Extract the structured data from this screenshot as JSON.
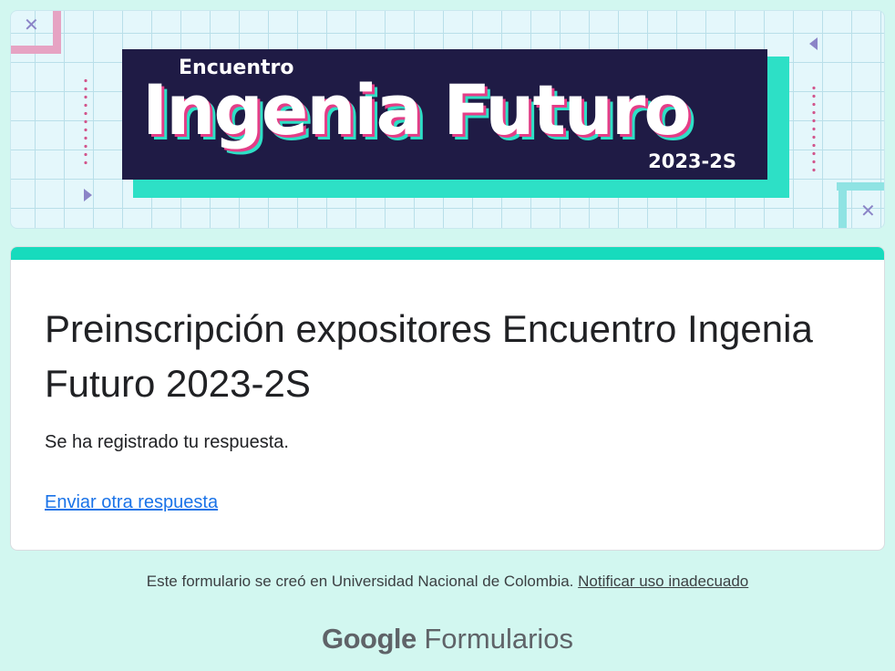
{
  "header": {
    "banner": {
      "event_small": "Encuentro",
      "event_big": "Ingenia Futuro",
      "event_year": "2023-2S"
    }
  },
  "form": {
    "title": "Preinscripción expositores Encuentro Ingenia Futuro 2023-2S",
    "confirmation_message": "Se ha registrado tu respuesta.",
    "submit_another_link": "Enviar otra respuesta"
  },
  "footer": {
    "created_note": "Este formulario se creó en Universidad Nacional de Colombia.",
    "report_link": "Notificar uso inadecuado",
    "brand_google": "Google",
    "brand_product": "Formularios"
  },
  "colors": {
    "page_background": "#d2f7f0",
    "accent": "#17dbbd",
    "link": "#1a73e8",
    "banner_dark": "#1f1b45",
    "banner_pink": "#e43d87"
  }
}
